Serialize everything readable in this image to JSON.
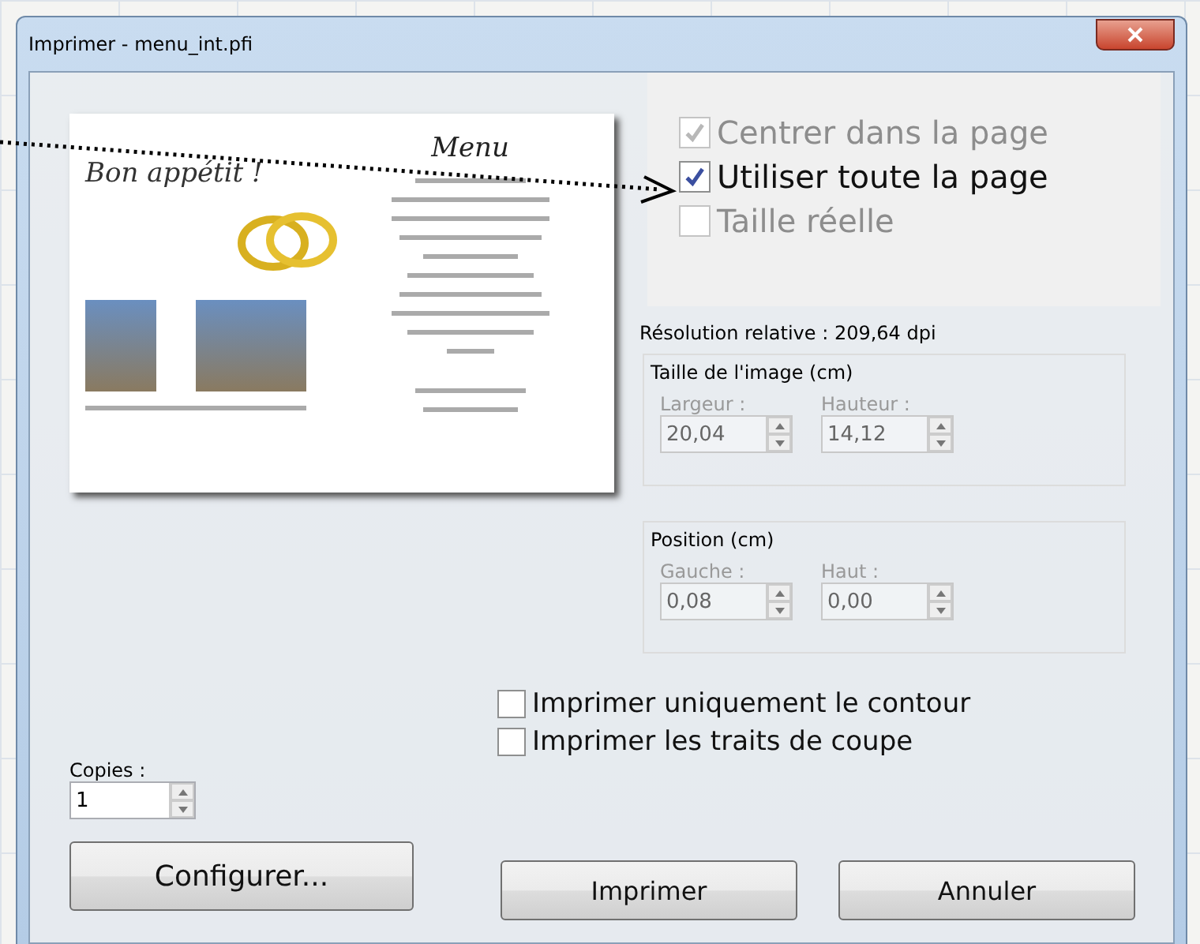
{
  "window": {
    "title": "Imprimer - menu_int.pfi"
  },
  "preview": {
    "heading": "Menu",
    "greeting": "Bon appétit !"
  },
  "layout_options": [
    {
      "label": "Centrer dans la page",
      "checked": true,
      "disabled": true
    },
    {
      "label": "Utiliser toute la page",
      "checked": true,
      "disabled": false
    },
    {
      "label": "Taille réelle",
      "checked": false,
      "disabled": true
    }
  ],
  "resolution": "Résolution relative : 209,64 dpi",
  "groups": [
    {
      "title": "Taille de l'image (cm)",
      "fields": [
        {
          "label": "Largeur :",
          "value": "20,04",
          "disabled": true
        },
        {
          "label": "Hauteur :",
          "value": "14,12",
          "disabled": true
        }
      ]
    },
    {
      "title": "Position (cm)",
      "fields": [
        {
          "label": "Gauche :",
          "value": "0,08",
          "disabled": true
        },
        {
          "label": "Haut :",
          "value": "0,00",
          "disabled": true
        }
      ]
    }
  ],
  "print_options": [
    {
      "label": "Imprimer uniquement le contour",
      "checked": false
    },
    {
      "label": "Imprimer les traits de coupe",
      "checked": false
    }
  ],
  "copies": {
    "label": "Copies :",
    "value": "1"
  },
  "buttons": [
    {
      "label": "Configurer..."
    },
    {
      "label": "Imprimer"
    },
    {
      "label": "Annuler"
    }
  ]
}
